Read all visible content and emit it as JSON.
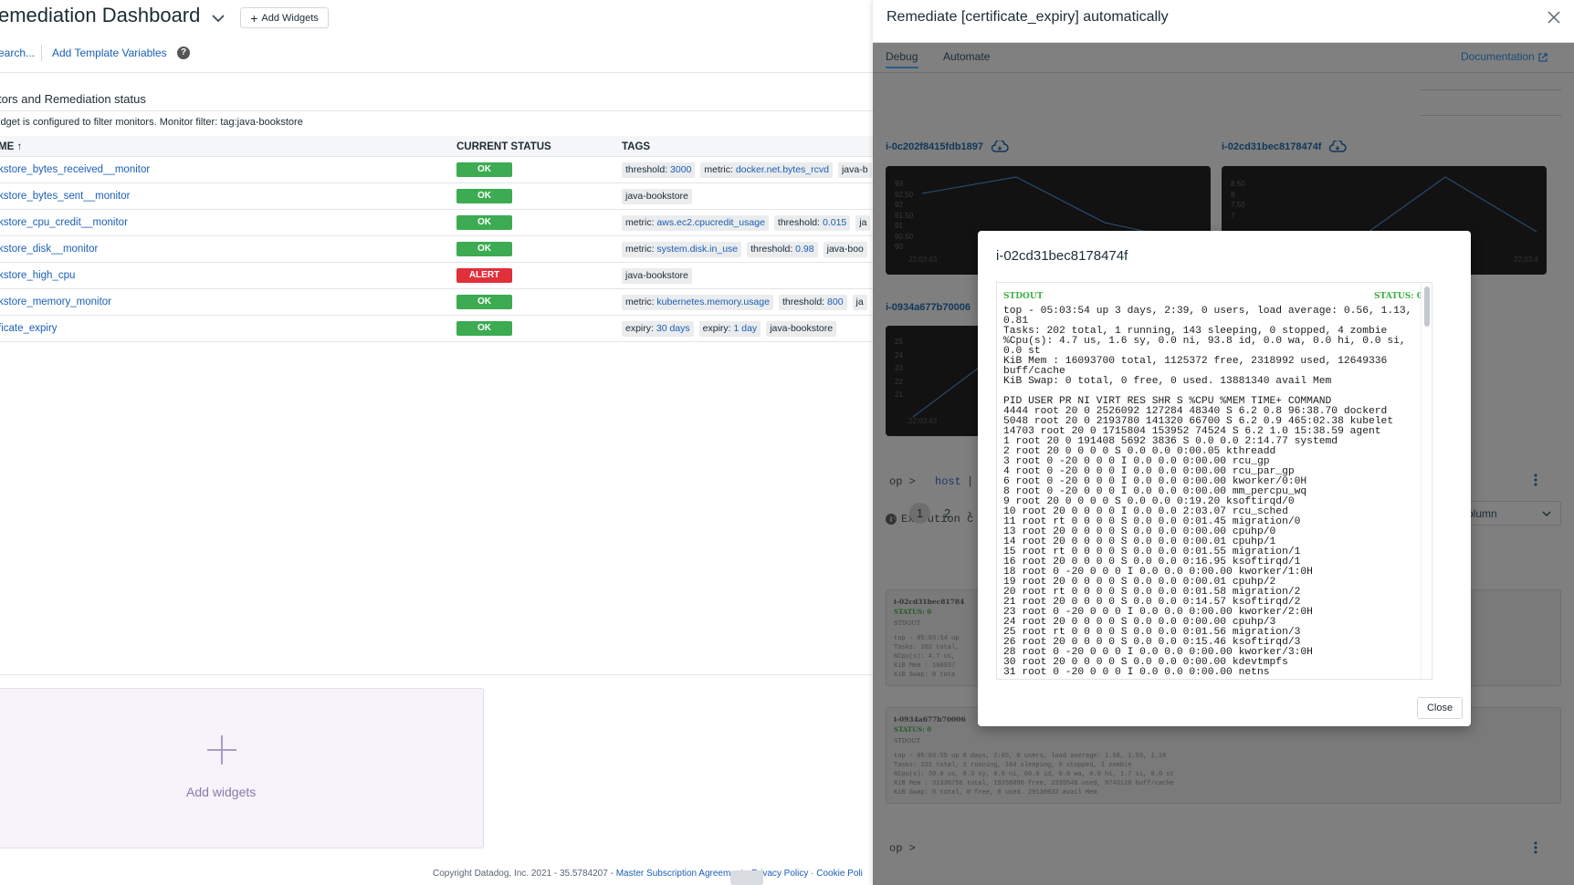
{
  "dashboard": {
    "title": "emediation Dashboard",
    "add_widgets_label": "Add Widgets",
    "search_link": "earch...",
    "template_vars_link": "Add Template Variables",
    "help_glyph": "?",
    "widget": {
      "title": "tors and Remediation status",
      "note": "idget is configured to filter monitors. Monitor filter: tag:java-bookstore",
      "columns": [
        "ME ↑",
        "CURRENT STATUS",
        "TAGS"
      ],
      "rows": [
        {
          "name": "kstore_bytes_received__monitor",
          "status": "OK",
          "tags": [
            {
              "k": "threshold:",
              "v": "3000"
            },
            {
              "k": "metric:",
              "v": "docker.net.bytes_rcvd"
            },
            {
              "k": "java-b",
              "v": ""
            }
          ]
        },
        {
          "name": "kstore_bytes_sent__monitor",
          "status": "OK",
          "tags": [
            {
              "k": "java-bookstore",
              "v": ""
            }
          ]
        },
        {
          "name": "kstore_cpu_credit__monitor",
          "status": "OK",
          "tags": [
            {
              "k": "metric:",
              "v": "aws.ec2.cpucredit_usage"
            },
            {
              "k": "threshold:",
              "v": "0.015"
            },
            {
              "k": "ja",
              "v": ""
            }
          ]
        },
        {
          "name": "kstore_disk__monitor",
          "status": "OK",
          "tags": [
            {
              "k": "metric:",
              "v": "system.disk.in_use"
            },
            {
              "k": "threshold:",
              "v": "0.98"
            },
            {
              "k": "java-boo",
              "v": ""
            }
          ]
        },
        {
          "name": "kstore_high_cpu",
          "status": "ALERT",
          "tags": [
            {
              "k": "java-bookstore",
              "v": ""
            }
          ]
        },
        {
          "name": "kstore_memory_monitor",
          "status": "OK",
          "tags": [
            {
              "k": "metric:",
              "v": "kubernetes.memory.usage"
            },
            {
              "k": "threshold:",
              "v": "800"
            },
            {
              "k": "ja",
              "v": ""
            }
          ]
        },
        {
          "name": "ficate_expiry",
          "status": "OK",
          "tags": [
            {
              "k": "expiry:",
              "v": "30 days"
            },
            {
              "k": "expiry:",
              "v": "1 day"
            },
            {
              "k": "java-bookstore",
              "v": ""
            }
          ]
        }
      ]
    },
    "add_widget_card_label": "Add widgets",
    "footer": {
      "copyright": "Copyright Datadog, Inc. 2021 - 35.5784207 - ",
      "msa": "Master Subscription Agreement",
      "sep1": " · ",
      "privacy": "Privacy Policy",
      "sep2": " · ",
      "cookie": "Cookie Poli"
    }
  },
  "panel": {
    "title": "Remediate [certificate_expiry] automatically",
    "tabs": [
      "Debug",
      "Automate"
    ],
    "doc_link": "Documentation",
    "hosts": [
      "i-0c202f8415fdb1897",
      "i-02cd31bec8178474f",
      "i-0934a677b70006"
    ],
    "chart1_ticks": [
      "93",
      "92.50",
      "92",
      "91.50",
      "91",
      "90.50",
      "90"
    ],
    "chart1_time": "22:03:43",
    "chart2_ticks": [
      "8.50",
      "8",
      "7.50",
      "7"
    ],
    "chart2_time": "22:03:4",
    "chart3_ticks": [
      "25",
      "24",
      "23",
      "22",
      "21"
    ],
    "chart3_time": "22:03:43",
    "query_op": "op >",
    "query_host": "host",
    "query_pipe": "|",
    "execution_note": "Execution c",
    "pager": [
      "1",
      "2"
    ],
    "column_select": "1 column",
    "bg_card1": {
      "host": "i-02cd31bec81784",
      "status": "STATUS: 0",
      "stdout": "STDOUT",
      "lines": [
        "top - 05:03:54 up",
        "Tasks: 202 total,",
        "%Cpu(s): 4.7 us,",
        "KiB Mem : 160937",
        "KiB Swap: 0 tota"
      ]
    },
    "bg_card2": {
      "host": "i-0934a677b70006",
      "status": "STATUS: 0",
      "stdout": "STDOUT",
      "lines": [
        "top - 05:03:55 up 6 days, 2:05, 0 users, load average: 1.58, 1.59, 1.18",
        "Tasks: 221 total, 1 running, 164 sleeping, 0 stopped, 1 zombie",
        "%Cpu(s): 30.0 us, 8.3 sy, 0.0 ni, 60.0 id, 0.0 wa, 0.0 hi, 1.7 si, 0.0 st",
        "KiB Mem : 31336756 total, 19258080 free, 2335548 used, 9743128 buff/cache",
        "KiB Swap: 0 total, 0 free, 0 used. 29130932 avail Mem"
      ]
    },
    "bottom_query": "op >"
  },
  "modal": {
    "title": "i-02cd31bec8178474f",
    "stdout_label": "STDOUT",
    "status_label": "STATUS: 0",
    "output": "top - 05:03:54 up 3 days, 2:39, 0 users, load average: 0.56, 1.13, 0.81\nTasks: 202 total, 1 running, 143 sleeping, 0 stopped, 4 zombie\n%Cpu(s): 4.7 us, 1.6 sy, 0.0 ni, 93.8 id, 0.0 wa, 0.0 hi, 0.0 si, 0.0 st\nKiB Mem : 16093700 total, 1125372 free, 2318992 used, 12649336 buff/cache\nKiB Swap: 0 total, 0 free, 0 used. 13881340 avail Mem\n\nPID USER PR NI VIRT RES SHR S %CPU %MEM TIME+ COMMAND\n4444 root 20 0 2526092 127284 48340 S 6.2 0.8 96:38.70 dockerd\n5048 root 20 0 2193780 141320 66700 S 6.2 0.9 465:02.38 kubelet\n14703 root 20 0 1715804 153952 74524 S 6.2 1.0 15:38.59 agent\n1 root 20 0 191408 5692 3836 S 0.0 0.0 2:14.77 systemd\n2 root 20 0 0 0 0 S 0.0 0.0 0:00.05 kthreadd\n3 root 0 -20 0 0 0 I 0.0 0.0 0:00.00 rcu_gp\n4 root 0 -20 0 0 0 I 0.0 0.0 0:00.00 rcu_par_gp\n6 root 0 -20 0 0 0 I 0.0 0.0 0:00.00 kworker/0:0H\n8 root 0 -20 0 0 0 I 0.0 0.0 0:00.00 mm_percpu_wq\n9 root 20 0 0 0 0 S 0.0 0.0 0:19.20 ksoftirqd/0\n10 root 20 0 0 0 0 I 0.0 0.0 2:03.07 rcu_sched\n11 root rt 0 0 0 0 S 0.0 0.0 0:01.45 migration/0\n13 root 20 0 0 0 0 S 0.0 0.0 0:00.00 cpuhp/0\n14 root 20 0 0 0 0 S 0.0 0.0 0:00.01 cpuhp/1\n15 root rt 0 0 0 0 S 0.0 0.0 0:01.55 migration/1\n16 root 20 0 0 0 0 S 0.0 0.0 0:16.95 ksoftirqd/1\n18 root 0 -20 0 0 0 I 0.0 0.0 0:00.00 kworker/1:0H\n19 root 20 0 0 0 0 S 0.0 0.0 0:00.01 cpuhp/2\n20 root rt 0 0 0 0 S 0.0 0.0 0:01.58 migration/2\n21 root 20 0 0 0 0 S 0.0 0.0 0:14.57 ksoftirqd/2\n23 root 0 -20 0 0 0 I 0.0 0.0 0:00.00 kworker/2:0H\n24 root 20 0 0 0 0 S 0.0 0.0 0:00.00 cpuhp/3\n25 root rt 0 0 0 0 S 0.0 0.0 0:01.56 migration/3\n26 root 20 0 0 0 0 S 0.0 0.0 0:15.46 ksoftirqd/3\n28 root 0 -20 0 0 0 I 0.0 0.0 0:00.00 kworker/3:0H\n30 root 20 0 0 0 0 S 0.0 0.0 0:00.00 kdevtmpfs\n31 root 0 -20 0 0 0 I 0.0 0.0 0:00.00 netns",
    "close_label": "Close"
  },
  "colors": {
    "ok": "#3dab52",
    "alert": "#e0303a",
    "link": "#1a5fb4",
    "overlay": "#7f7f7f"
  }
}
